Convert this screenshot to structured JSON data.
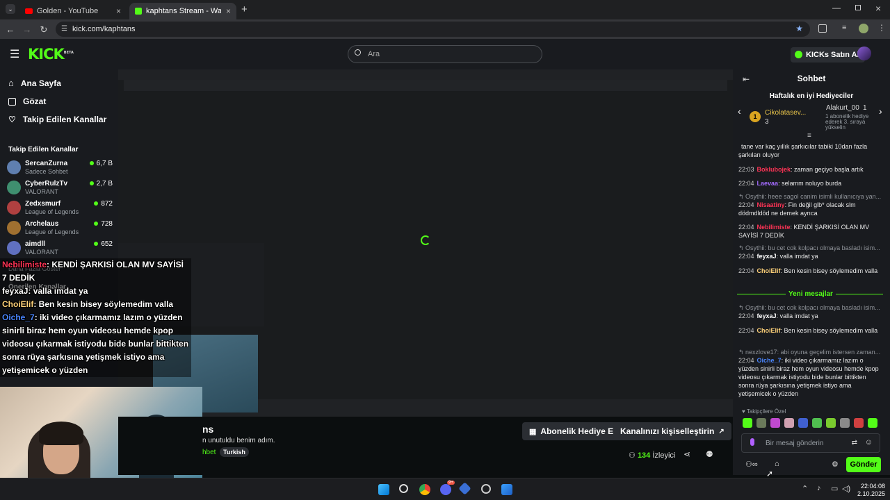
{
  "browser": {
    "tabs": [
      {
        "title": "Golden - YouTube",
        "active": false
      },
      {
        "title": "kaphtans Stream - Watch Live o",
        "active": true
      }
    ],
    "url": "kick.com/kaphtans"
  },
  "header": {
    "logo": "KICK",
    "logo_badge": "BETA",
    "search_placeholder": "Ara",
    "kicks_button": "KICKs Satın Al"
  },
  "nav": {
    "items": [
      {
        "label": "Ana Sayfa",
        "icon": "home-icon"
      },
      {
        "label": "Gözat",
        "icon": "browse-icon"
      },
      {
        "label": "Takip Edilen Kanallar",
        "icon": "heart-icon"
      }
    ],
    "followed_heading": "Takip Edilen Kanallar",
    "channels": [
      {
        "name": "SercanZurna",
        "category": "Sadece Sohbet",
        "viewers": "6,7 B",
        "color": "#5f7fb0"
      },
      {
        "name": "CyberRulzTv",
        "category": "VALORANT",
        "viewers": "2,7 B",
        "color": "#3f8f6f"
      },
      {
        "name": "Zedxsmurf",
        "category": "League of Legends",
        "viewers": "872",
        "color": "#b04040"
      },
      {
        "name": "Archelaus",
        "category": "League of Legends",
        "viewers": "728",
        "color": "#a07030"
      },
      {
        "name": "aimdll",
        "category": "VALORANT",
        "viewers": "652",
        "color": "#6070c0"
      }
    ],
    "show_more": "Daha Fazla Göster",
    "recommended_heading": "Önerilen Kanallar"
  },
  "overlay_chat": [
    {
      "user": "Nebilimiste",
      "color": "#ff3355",
      "text": ": KENDİ ŞARKISİ OLAN MV SAYİSİ 7 DEDİK"
    },
    {
      "user": "feyxaJ",
      "color": "#ffffff",
      "text": ": valla imdat ya"
    },
    {
      "user": "ChoiElif",
      "color": "#ffd27a",
      "text": ": Ben kesin bisey söylemedim valla"
    },
    {
      "user": "Oiche_7",
      "color": "#4a86ff",
      "text": ": iki video çıkarmamız lazım o yüzden sinirli biraz hem oyun videosu hemde kpop videosu çıkarmak istiyodu bide bunlar bittikten sonra rüya şarkısına yetişmek istiyo ama yetişemicek o yüzden"
    }
  ],
  "stream": {
    "title_fragment": "ns",
    "subtitle_fragment": "n unutuldu benim adım.",
    "category_fragment": "hbet",
    "language_tag": "Turkish",
    "gift_sub_button": "Abonelik Hediye Et",
    "customize_button": "Kanalınızı kişiselleştirin",
    "viewer_count": "134",
    "viewer_label": "İzleyici"
  },
  "chat": {
    "title": "Sohbet",
    "top_gifters_title": "Haftalık en iyi Hediyeciler",
    "gifter1": {
      "rank": "1",
      "name": "Cikolatasev...",
      "count": "3"
    },
    "gifter2": {
      "name": "Alakurt_00",
      "count": "1",
      "note": "1 abonelik hediye ederek 3. sıraya yükselin"
    },
    "messages": [
      {
        "time": "",
        "user": "",
        "color": "#e8e8e8",
        "text": "tane var kaç yıllık şarkıcılar tabiki 10dan fazla şarkıları oluyor",
        "reply": ""
      },
      {
        "time": "22:03",
        "user": "Boklubojek",
        "color": "#ff3355",
        "text": ": zaman geçiyo başla artık",
        "reply": ""
      },
      {
        "time": "22:04",
        "user": "Laevaa",
        "color": "#a46cff",
        "text": ": selamm noluyo burda",
        "reply": ""
      },
      {
        "time": "22:04",
        "user": "Nisaatiny",
        "color": "#ff3355",
        "text": ": Fin değil glb* olacak slm dödmdldöd ne demek ayrıca",
        "reply": "Osythii: heee sagol canim isimli kullanıcıya yan..."
      },
      {
        "time": "22:04",
        "user": "Nebilimiste",
        "color": "#ff3355",
        "text": ": KENDİ ŞARKISİ OLAN MV SAYİSİ 7 DEDİK",
        "reply": ""
      },
      {
        "time": "22:04",
        "user": "feyxaJ",
        "color": "#ffffff",
        "text": ": valla imdat ya",
        "reply": "Osythii: bu cet cok kolpacı olmaya basladı isim..."
      },
      {
        "time": "22:04",
        "user": "ChoiElif",
        "color": "#ffd27a",
        "text": ": Ben kesin bisey söylemedim valla",
        "reply": ""
      }
    ],
    "new_messages_label": "Yeni mesajlar",
    "new_messages": [
      {
        "time": "22:04",
        "user": "feyxaJ",
        "color": "#ffffff",
        "text": ": valla imdat ya",
        "reply": "Osythii: bu cet cok kolpacı olmaya basladı isim..."
      },
      {
        "time": "22:04",
        "user": "ChoiElif",
        "color": "#ffd27a",
        "text": ": Ben kesin bisey söylemedim valla",
        "reply": ""
      },
      {
        "time": "22:04",
        "user": "Oiche_7",
        "color": "#4a86ff",
        "text": ": iki video çıkarmamız lazım o yüzden sinirli biraz hem oyun videosu hemde kpop videosu çıkarmak istiyodu bide bunlar bittikten sonra rüya şarkısına yetişmek istiyo ama yetişemicek o yüzden",
        "reply": "nexzlove17: abi oyuna geçelim istersen zaman..."
      }
    ],
    "followers_special": "Takipçilere Özel",
    "input_placeholder": "Bir mesaj gönderin",
    "send_button": "Gönder"
  },
  "taskbar": {
    "time": "22:04:08",
    "date": "2.10.2025",
    "discord_badge": "9+"
  }
}
